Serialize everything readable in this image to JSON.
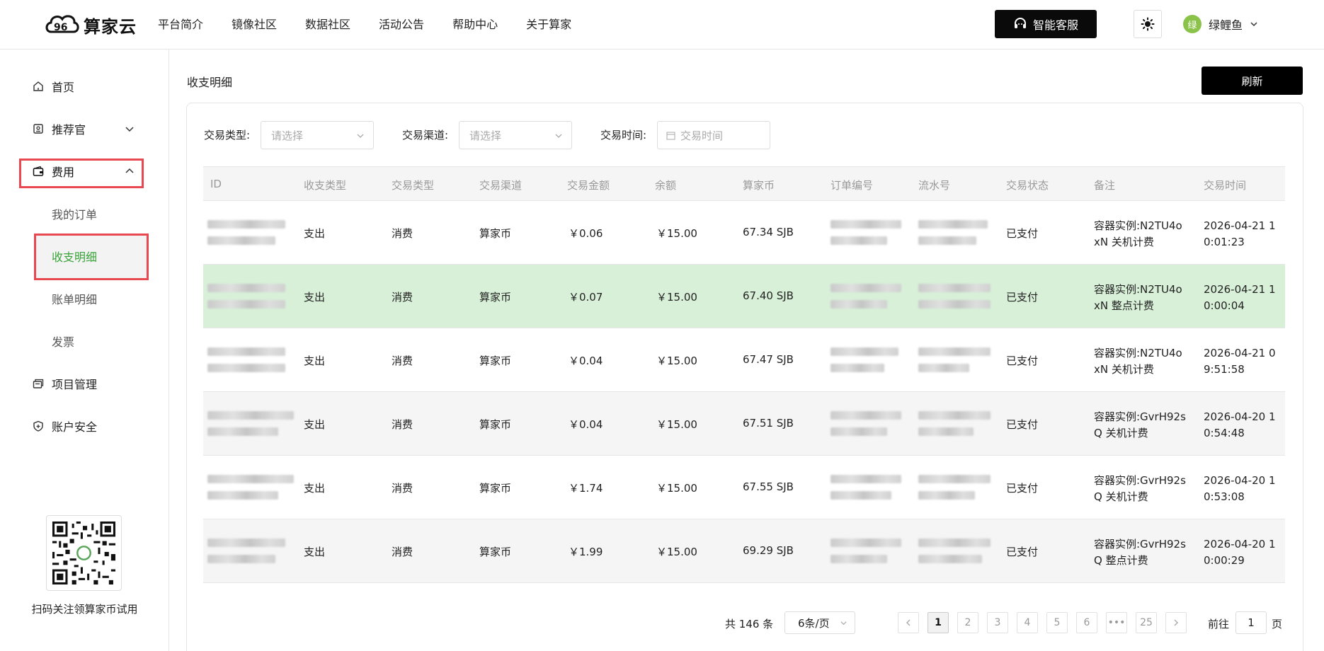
{
  "header": {
    "logo_text": "算家云",
    "nav": [
      "平台简介",
      "镜像社区",
      "数据社区",
      "活动公告",
      "帮助中心",
      "关于算家"
    ],
    "customer_service": "智能客服",
    "avatar_text": "绿",
    "username": "绿鲤鱼"
  },
  "sidebar": {
    "home": "首页",
    "recommender": "推荐官",
    "fees": "费用",
    "my_orders": "我的订单",
    "income_expense": "收支明细",
    "bill_details": "账单明细",
    "invoice": "发票",
    "project_mgmt": "项目管理",
    "account_security": "账户安全",
    "qr_caption": "扫码关注领算家币试用",
    "accent_color": "#3aa33a",
    "highlight_color": "#e8484f"
  },
  "main": {
    "title": "收支明细",
    "refresh": "刷新",
    "filters": {
      "type_label": "交易类型:",
      "type_placeholder": "请选择",
      "channel_label": "交易渠道:",
      "channel_placeholder": "请选择",
      "time_label": "交易时间:",
      "time_placeholder": "交易时间"
    },
    "columns": [
      "ID",
      "收支类型",
      "交易类型",
      "交易渠道",
      "交易金额",
      "余额",
      "算家币",
      "订单编号",
      "流水号",
      "交易状态",
      "备注",
      "交易时间"
    ],
    "rows": [
      {
        "io": "支出",
        "type": "消费",
        "channel": "算家币",
        "amount": "￥0.06",
        "balance": "￥15.00",
        "coin": "67.34 SJB",
        "status": "已支付",
        "note_1": "容器实例:N2TU4o",
        "note_2": "xN 关机计费",
        "time_1": "2026-04-21 1",
        "time_2": "0:01:23"
      },
      {
        "io": "支出",
        "type": "消费",
        "channel": "算家币",
        "amount": "￥0.07",
        "balance": "￥15.00",
        "coin": "67.40 SJB",
        "status": "已支付",
        "note_1": "容器实例:N2TU4o",
        "note_2": "xN 整点计费",
        "time_1": "2026-04-21 1",
        "time_2": "0:00:04"
      },
      {
        "io": "支出",
        "type": "消费",
        "channel": "算家币",
        "amount": "￥0.04",
        "balance": "￥15.00",
        "coin": "67.47 SJB",
        "status": "已支付",
        "note_1": "容器实例:N2TU4o",
        "note_2": "xN 关机计费",
        "time_1": "2026-04-21 0",
        "time_2": "9:51:58"
      },
      {
        "io": "支出",
        "type": "消费",
        "channel": "算家币",
        "amount": "￥0.04",
        "balance": "￥15.00",
        "coin": "67.51 SJB",
        "status": "已支付",
        "note_1": "容器实例:GvrH92s",
        "note_2": "Q 关机计费",
        "time_1": "2026-04-20 1",
        "time_2": "0:54:48"
      },
      {
        "io": "支出",
        "type": "消费",
        "channel": "算家币",
        "amount": "￥1.74",
        "balance": "￥15.00",
        "coin": "67.55 SJB",
        "status": "已支付",
        "note_1": "容器实例:GvrH92s",
        "note_2": "Q 关机计费",
        "time_1": "2026-04-20 1",
        "time_2": "0:53:08"
      },
      {
        "io": "支出",
        "type": "消费",
        "channel": "算家币",
        "amount": "￥1.99",
        "balance": "￥15.00",
        "coin": "69.29 SJB",
        "status": "已支付",
        "note_1": "容器实例:GvrH92s",
        "note_2": "Q 整点计费",
        "time_1": "2026-04-20 1",
        "time_2": "0:00:29"
      }
    ],
    "pagination": {
      "total": "共 146 条",
      "page_size": "6条/页",
      "pages": [
        "1",
        "2",
        "3",
        "4",
        "5",
        "6",
        "•••",
        "25"
      ],
      "goto_label": "前往",
      "goto_value": "1",
      "goto_suffix": "页"
    }
  }
}
